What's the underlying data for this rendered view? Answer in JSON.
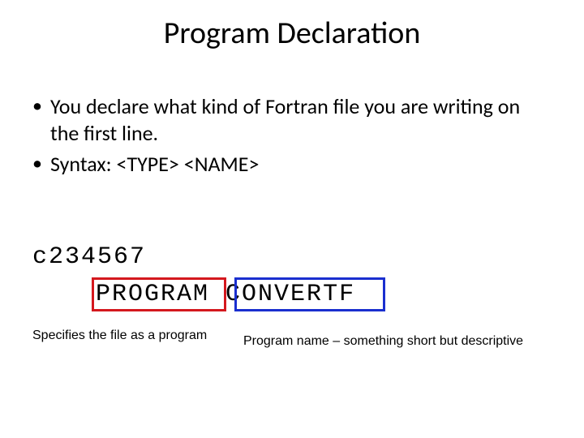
{
  "title": "Program Declaration",
  "bullets": {
    "item1": "You declare what kind of Fortran file you are writing on the first line.",
    "item2": "Syntax: <TYPE> <NAME>"
  },
  "code": {
    "line1": "c234567",
    "prog_keyword": "PROGRAM",
    "prog_name": "CONVERTF"
  },
  "captions": {
    "left": "Specifies the file as a program",
    "right": "Program name – something short but descriptive"
  },
  "colors": {
    "red_box": "#d4181e",
    "blue_box": "#1a2fcf"
  }
}
